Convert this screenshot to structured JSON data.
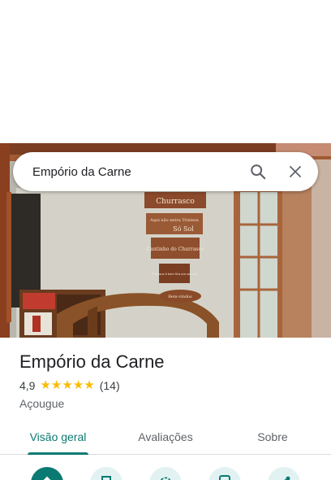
{
  "search": {
    "query": "Empório da Carne",
    "search_icon": "search-icon",
    "close_icon": "close-icon"
  },
  "place": {
    "name": "Empório da Carne",
    "rating": "4,9",
    "stars": 5,
    "review_count": "(14)",
    "category": "Açougue",
    "photo_signs": {
      "sign_1": "Churrasco",
      "sign_2": "Aqui não entra Tristeza",
      "sign_3": "Só Sol",
      "sign_4": "Cantinho do Churrasco",
      "sign_5": "Tudo que é bom fica pra sempre",
      "sign_6": "Bem-vindos"
    }
  },
  "tabs": [
    {
      "label": "Visão geral",
      "active": true
    },
    {
      "label": "Avaliações",
      "active": false
    },
    {
      "label": "Sobre",
      "active": false
    }
  ],
  "actions": [
    {
      "icon": "directions-icon",
      "style": "primary"
    },
    {
      "icon": "save-icon",
      "style": "secondary"
    },
    {
      "icon": "nearby-icon",
      "style": "secondary"
    },
    {
      "icon": "phone-icon",
      "style": "secondary"
    },
    {
      "icon": "share-icon",
      "style": "secondary"
    }
  ],
  "colors": {
    "accent": "#0b7a72",
    "star": "#fbbc04",
    "chip_bg": "#e2f2f2"
  }
}
